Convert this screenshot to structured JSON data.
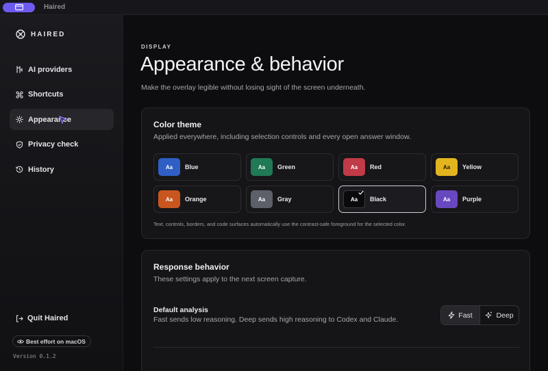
{
  "titlebar": {
    "app_name": "Haired"
  },
  "sidebar": {
    "brand": "HAIRED",
    "items": [
      {
        "label": "AI providers",
        "icon": "providers-icon",
        "active": false
      },
      {
        "label": "Shortcuts",
        "icon": "command-icon",
        "active": false
      },
      {
        "label": "Appearance",
        "icon": "sun-icon",
        "active": true
      },
      {
        "label": "Privacy check",
        "icon": "shield-check-icon",
        "active": false
      },
      {
        "label": "History",
        "icon": "history-icon",
        "active": false
      }
    ],
    "quit_label": "Quit Haired",
    "effort_badge": "Best effort on macOS",
    "version": "Version 0.1.2"
  },
  "page": {
    "eyebrow": "DISPLAY",
    "title": "Appearance & behavior",
    "subtitle": "Make the overlay legible without losing sight of the screen underneath."
  },
  "color_theme": {
    "title": "Color theme",
    "subtitle": "Applied everywhere, including selection controls and every open answer window.",
    "chip_text": "Aa",
    "selected": "Black",
    "swatches": [
      {
        "label": "Blue",
        "color": "#2f5fc4"
      },
      {
        "label": "Green",
        "color": "#1f7a55"
      },
      {
        "label": "Red",
        "color": "#c03a48"
      },
      {
        "label": "Yellow",
        "color": "#e2b41e"
      },
      {
        "label": "Orange",
        "color": "#c9561e"
      },
      {
        "label": "Gray",
        "color": "#5d6068"
      },
      {
        "label": "Black",
        "color": "#0a0a0c"
      },
      {
        "label": "Purple",
        "color": "#6848c0"
      }
    ],
    "note": "Text, controls, borders, and code surfaces automatically use the contrast-safe foreground for the selected color."
  },
  "response_behavior": {
    "title": "Response behavior",
    "subtitle": "These settings apply to the next screen capture.",
    "default_analysis": {
      "title": "Default analysis",
      "description": "Fast sends low reasoning. Deep sends high reasoning to Codex and Claude.",
      "options": [
        "Fast",
        "Deep"
      ],
      "selected": "Fast"
    }
  },
  "colors": {
    "accent": "#6d5bf0",
    "background": "#0d0d10",
    "card": "#151518"
  }
}
